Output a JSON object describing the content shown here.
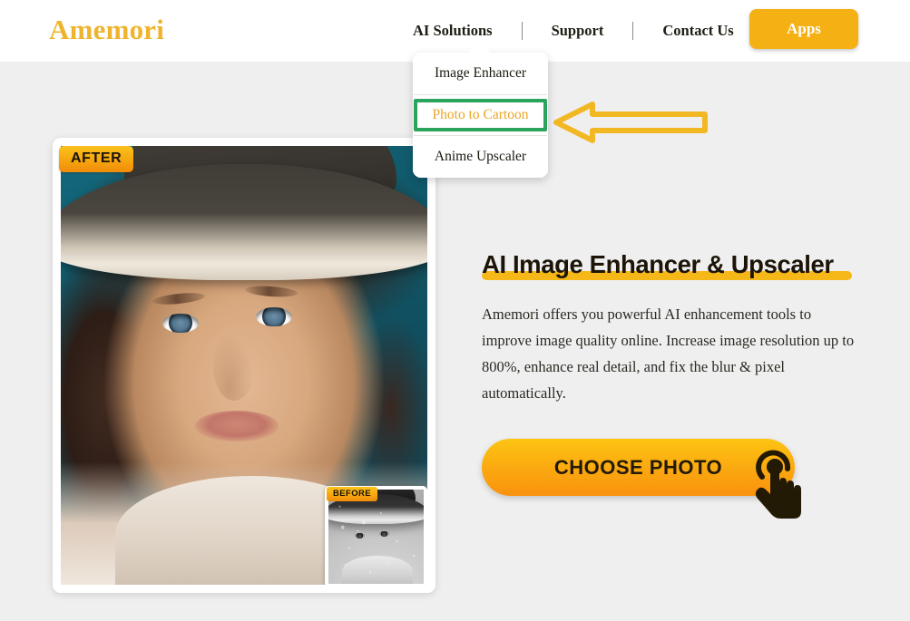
{
  "brand": {
    "logo_text": "Amemori",
    "logo_color": "#efb42e"
  },
  "header": {
    "nav_items": [
      {
        "label": "AI Solutions",
        "has_dropdown": true
      },
      {
        "label": "Support",
        "has_dropdown": false
      },
      {
        "label": "Contact Us",
        "has_dropdown": false
      }
    ],
    "apps_button": {
      "label": "Apps",
      "background": "#f5b013",
      "text_color": "#ffffff"
    }
  },
  "dropdown": {
    "open_for": "AI Solutions",
    "items": [
      {
        "label": "Image Enhancer",
        "selected": false
      },
      {
        "label": "Photo to Cartoon",
        "selected": true
      },
      {
        "label": "Anime Upscaler",
        "selected": false
      }
    ],
    "selection_highlight_color": "#2aa35c",
    "selected_text_color": "#e9a625"
  },
  "annotation": {
    "arrow_icon": "left-arrow-outline-icon",
    "arrow_color": "#f2b824",
    "points_to": "Photo to Cartoon"
  },
  "showcase": {
    "after_badge": "AFTER",
    "before_badge": "BEFORE",
    "badge_text_color": "#191206",
    "badge_background": "#f6a50f",
    "after_image_alt": "restored color portrait of woman wearing hat",
    "before_image_alt": "damaged grainy black and white portrait"
  },
  "main": {
    "headline": "AI Image Enhancer & Upscaler",
    "headline_underline_color": "#f6b718",
    "paragraph": "Amemori offers you powerful AI enhancement tools to improve image quality online. Increase image resolution up to 800%, enhance real detail, and fix the blur & pixel automatically.",
    "cta": {
      "label": "CHOOSE PHOTO",
      "icon": "tap-hand-icon",
      "background": "#fbae10",
      "text_color": "#231a06"
    }
  },
  "page": {
    "background": "#efefef",
    "header_background": "#ffffff"
  }
}
